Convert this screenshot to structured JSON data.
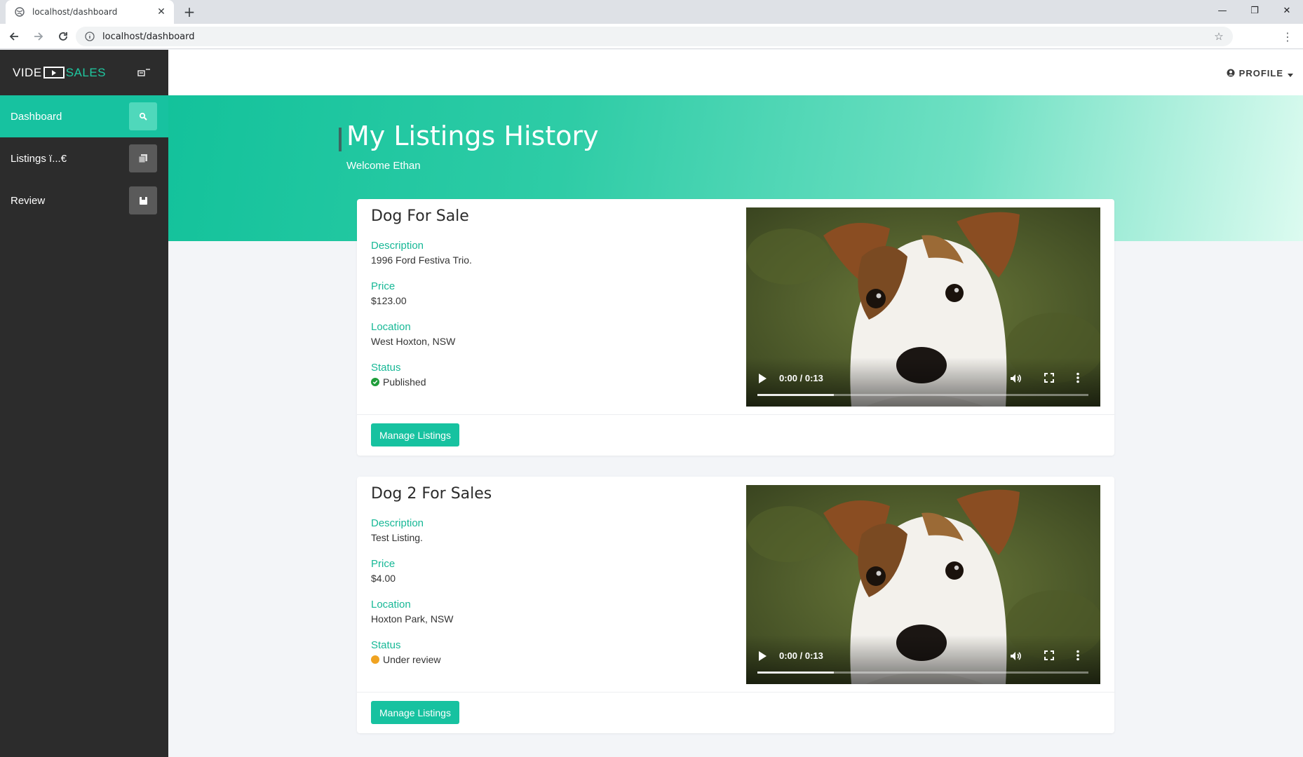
{
  "browser": {
    "tab_title": "localhost/dashboard",
    "url": "localhost/dashboard"
  },
  "brand": {
    "part1": "VIDE",
    "part2": "SALES"
  },
  "sidebar": {
    "items": [
      {
        "label": "Dashboard",
        "icon": "search-icon",
        "active": true
      },
      {
        "label": "Listings ï...€",
        "icon": "copy-icon",
        "active": false
      },
      {
        "label": "Review",
        "icon": "note-icon",
        "active": false
      }
    ]
  },
  "topnav": {
    "profile_label": "PROFILE"
  },
  "hero": {
    "title": "My Listings History",
    "subtitle": "Welcome Ethan"
  },
  "labels": {
    "description": "Description",
    "price": "Price",
    "location": "Location",
    "status": "Status"
  },
  "listings": [
    {
      "title": "Dog For Sale",
      "description": "1996 Ford Festiva Trio.",
      "price": "$123.00",
      "location": "West Hoxton, NSW",
      "status": "Published",
      "status_color": "#1f9d3a",
      "video_time": "0:00 / 0:13",
      "video_progress": 0.23,
      "button_label": "Manage Listings"
    },
    {
      "title": "Dog 2 For Sales",
      "description": "Test Listing.",
      "price": "$4.00",
      "location": "Hoxton Park, NSW",
      "status": "Under review",
      "status_color": "#f0a321",
      "video_time": "0:00 / 0:13",
      "video_progress": 0.23,
      "button_label": "Manage Listings"
    }
  ],
  "colors": {
    "accent": "#17c2a0",
    "sidebar_bg": "#2c2c2c",
    "label_green": "#17b896"
  }
}
